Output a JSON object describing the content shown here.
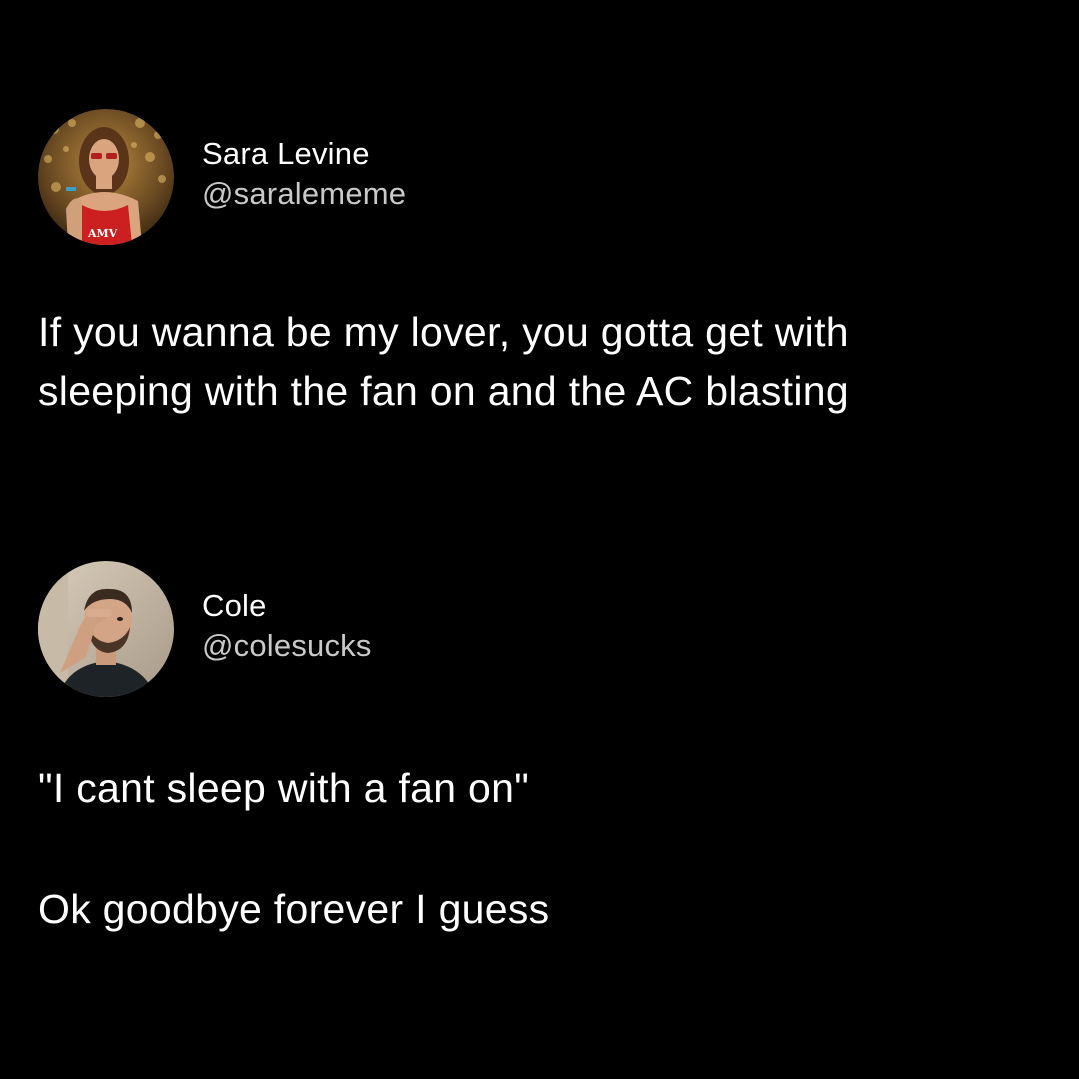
{
  "tweets": [
    {
      "author": {
        "name": "Sara Levine",
        "handle": "@saralememe",
        "avatar_icon": "avatar-photo-woman-red-top"
      },
      "lines": [
        "If you wanna be my lover, you gotta get with",
        "sleeping with the fan on and the AC blasting"
      ]
    },
    {
      "author": {
        "name": "Cole",
        "handle": "@colesucks",
        "avatar_icon": "avatar-photo-man-saluting"
      },
      "paragraphs": [
        "\"I cant sleep with a fan on\"",
        "Ok goodbye forever I guess"
      ]
    }
  ],
  "colors": {
    "background": "#000000",
    "text": "#ffffff",
    "handle": "#c9c9c9"
  }
}
